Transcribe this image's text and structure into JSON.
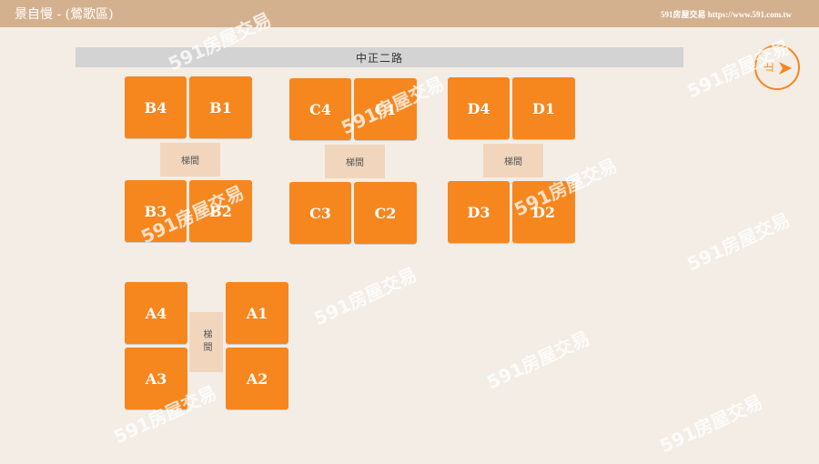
{
  "header": {
    "title": "景自慢  -  (鶯歌區)",
    "source": "591房屋交易 https://www.591.com.tw"
  },
  "road": {
    "label": "中正二路"
  },
  "stairs": {
    "label": "梯間"
  },
  "units": {
    "B4": "B4",
    "B1": "B1",
    "B3": "B3",
    "B2": "B2",
    "C4": "C4",
    "C1": "C1",
    "C3": "C3",
    "C2": "C2",
    "D4": "D4",
    "D1": "D1",
    "D3": "D3",
    "D2": "D2",
    "A4": "A4",
    "A1": "A1",
    "A3": "A3",
    "A2": "A2"
  },
  "next_button": {
    "label": "止"
  },
  "watermark": {
    "text": "591房屋交易"
  },
  "colors": {
    "header": "#d4b18e",
    "unit": "#f6861e",
    "stair": "#f1d6bd",
    "road": "#d3d3d3",
    "background": "#f3ede6"
  }
}
